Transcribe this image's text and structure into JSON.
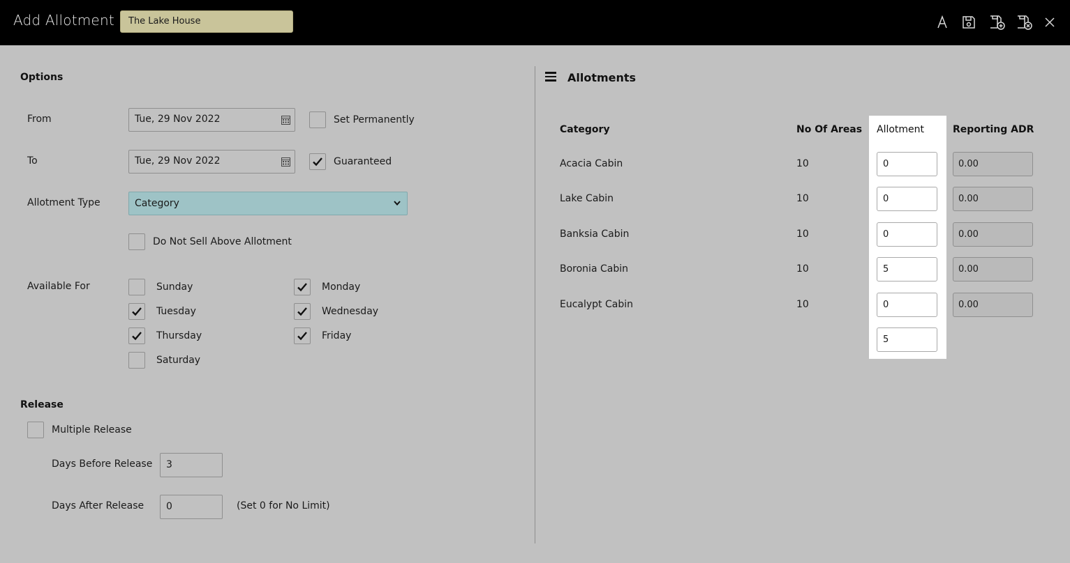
{
  "header": {
    "title": "Add Allotment",
    "property": "The Lake House",
    "icons": [
      "font-icon",
      "save-icon",
      "save-add-icon",
      "save-close-icon",
      "close-icon"
    ]
  },
  "options": {
    "section_title": "Options",
    "from_label": "From",
    "from_value": "Tue, 29 Nov 2022",
    "set_permanently_label": "Set Permanently",
    "set_permanently_checked": false,
    "to_label": "To",
    "to_value": "Tue, 29 Nov 2022",
    "guaranteed_label": "Guaranteed",
    "guaranteed_checked": true,
    "allotment_type_label": "Allotment Type",
    "allotment_type_value": "Category",
    "do_not_sell_label": "Do Not Sell Above Allotment",
    "do_not_sell_checked": false,
    "available_for_label": "Available For",
    "days": [
      {
        "label": "Sunday",
        "checked": false
      },
      {
        "label": "Monday",
        "checked": true
      },
      {
        "label": "Tuesday",
        "checked": true
      },
      {
        "label": "Wednesday",
        "checked": true
      },
      {
        "label": "Thursday",
        "checked": true
      },
      {
        "label": "Friday",
        "checked": true
      },
      {
        "label": "Saturday",
        "checked": false
      }
    ]
  },
  "release": {
    "section_title": "Release",
    "multiple_release_label": "Multiple Release",
    "multiple_release_checked": false,
    "days_before_label": "Days Before Release",
    "days_before_value": "3",
    "days_after_label": "Days After Release",
    "days_after_value": "0",
    "days_after_hint": "(Set 0 for No Limit)"
  },
  "allotments": {
    "title": "Allotments",
    "columns": [
      "Category",
      "No Of Areas",
      "Allotment",
      "Reporting ADR"
    ],
    "rows": [
      {
        "category": "Acacia Cabin",
        "areas": "10",
        "allotment": "0",
        "adr": "0.00"
      },
      {
        "category": "Lake Cabin",
        "areas": "10",
        "allotment": "0",
        "adr": "0.00"
      },
      {
        "category": "Banksia Cabin",
        "areas": "10",
        "allotment": "0",
        "adr": "0.00"
      },
      {
        "category": "Boronia Cabin",
        "areas": "10",
        "allotment": "5",
        "adr": "0.00"
      },
      {
        "category": "Eucalypt Cabin",
        "areas": "10",
        "allotment": "0",
        "adr": "0.00"
      }
    ],
    "total_allotment": "5"
  }
}
